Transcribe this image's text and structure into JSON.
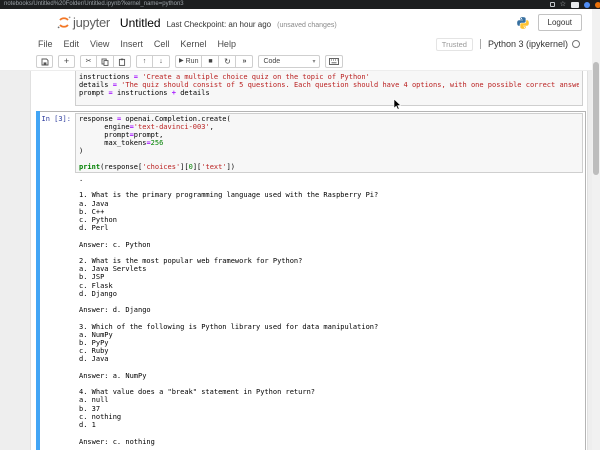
{
  "browser": {
    "url": "notebooks/Untitled%20Folder/Untitled.ipynb?kernel_name=python3"
  },
  "header": {
    "logo_text": "jupyter",
    "title": "Untitled",
    "checkpoint": "Last Checkpoint: an hour ago",
    "unsaved": "(unsaved changes)",
    "logout_label": "Logout"
  },
  "menu": {
    "items": [
      "File",
      "Edit",
      "View",
      "Insert",
      "Cell",
      "Kernel",
      "Help"
    ],
    "trusted_label": "Trusted",
    "kernel_label": "Python 3 (ipykernel)"
  },
  "toolbar": {
    "run_label": "Run",
    "cell_type": "Code"
  },
  "notebook": {
    "cell_above": {
      "code": [
        [
          [
            "instructions ",
            ""
          ],
          [
            "= ",
            "op"
          ],
          [
            "'Create a multiple choice quiz on the topic of Python'",
            "str"
          ]
        ],
        [
          [
            "details ",
            ""
          ],
          [
            "= ",
            "op"
          ],
          [
            "'The quiz should consist of 5 questions. Each question should have 4 options, with one possible correct answe",
            "str"
          ]
        ],
        [
          [
            "prompt ",
            ""
          ],
          [
            "= ",
            "op"
          ],
          [
            "instructions ",
            ""
          ],
          [
            "+ ",
            "op"
          ],
          [
            "details",
            ""
          ]
        ]
      ]
    },
    "active_cell": {
      "prompt": "In [3]:",
      "code": [
        [
          [
            "response ",
            ""
          ],
          [
            "= ",
            "op"
          ],
          [
            "openai.Completion.create(",
            ""
          ]
        ],
        [
          [
            "      engine",
            ""
          ],
          [
            "=",
            "op"
          ],
          [
            "'text-davinci-003'",
            "str"
          ],
          [
            ",",
            ""
          ]
        ],
        [
          [
            "      prompt",
            ""
          ],
          [
            "=",
            "op"
          ],
          [
            "prompt,",
            ""
          ]
        ],
        [
          [
            "      max_tokens",
            ""
          ],
          [
            "=",
            "op"
          ],
          [
            "256",
            "num"
          ]
        ],
        [
          [
            ")",
            ""
          ]
        ],
        [
          [
            " ",
            ""
          ]
        ],
        [
          [
            "print",
            "kw"
          ],
          [
            "(response[",
            ""
          ],
          [
            "'choices'",
            "str"
          ],
          [
            "][",
            ""
          ],
          [
            "0",
            "num"
          ],
          [
            "][",
            ""
          ],
          [
            "'text'",
            "str"
          ],
          [
            "])",
            ""
          ]
        ]
      ]
    },
    "output_lines": [
      ".",
      "",
      "1. What is the primary programming language used with the Raspberry Pi?",
      "a. Java",
      "b. C++",
      "c. Python",
      "d. Perl",
      "",
      "Answer: c. Python",
      "",
      "2. What is the most popular web framework for Python?",
      "a. Java Servlets",
      "b. JSP",
      "c. Flask",
      "d. Django",
      "",
      "Answer: d. Django",
      "",
      "3. Which of the following is Python library used for data manipulation?",
      "a. NumPy",
      "b. PyPy",
      "c. Ruby",
      "d. Java",
      "",
      "Answer: a. NumPy",
      "",
      "4. What value does a \"break\" statement in Python return?",
      "a. null",
      "b. 37",
      "c. nothing",
      "d. 1",
      "",
      "Answer: c. nothing"
    ]
  },
  "colors": {
    "jupyter_orange": "#F37726",
    "selection_blue": "#42A5F5",
    "in_prompt_navy": "#303F9F",
    "string_red": "#BA2121",
    "number_green": "#008000",
    "operator_purple": "#AA22FF"
  }
}
